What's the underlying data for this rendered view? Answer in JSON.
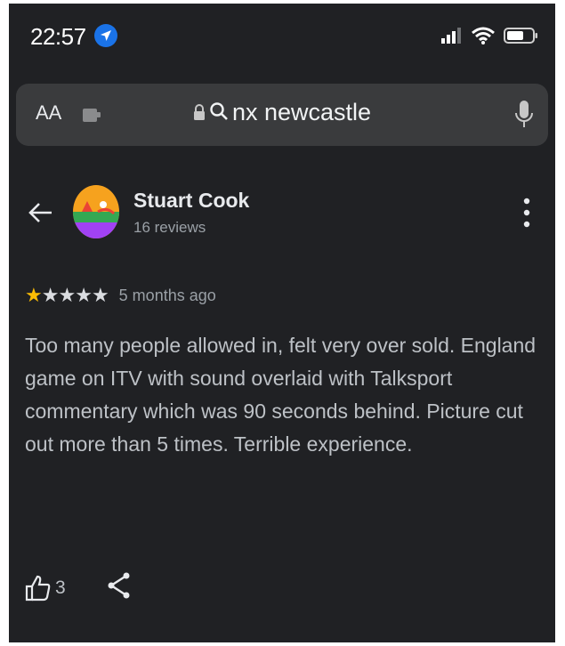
{
  "status_bar": {
    "time": "22:57"
  },
  "browser": {
    "text_size_label": "AA",
    "url_text": "nx newcastle"
  },
  "review": {
    "reviewer_name": "Stuart Cook",
    "review_count": "16 reviews",
    "rating": 1,
    "rating_max": 5,
    "time_ago": "5 months ago",
    "text": "Too many people allowed in, felt very over sold. England game on ITV with sound overlaid with Talksport commentary which was 90 seconds behind. Picture cut out more than 5 times. Terrible experience.",
    "like_count": "3"
  },
  "colors": {
    "star_filled": "#fbbc04",
    "star_empty": "#dadce0",
    "location_badge": "#1a73e8"
  }
}
